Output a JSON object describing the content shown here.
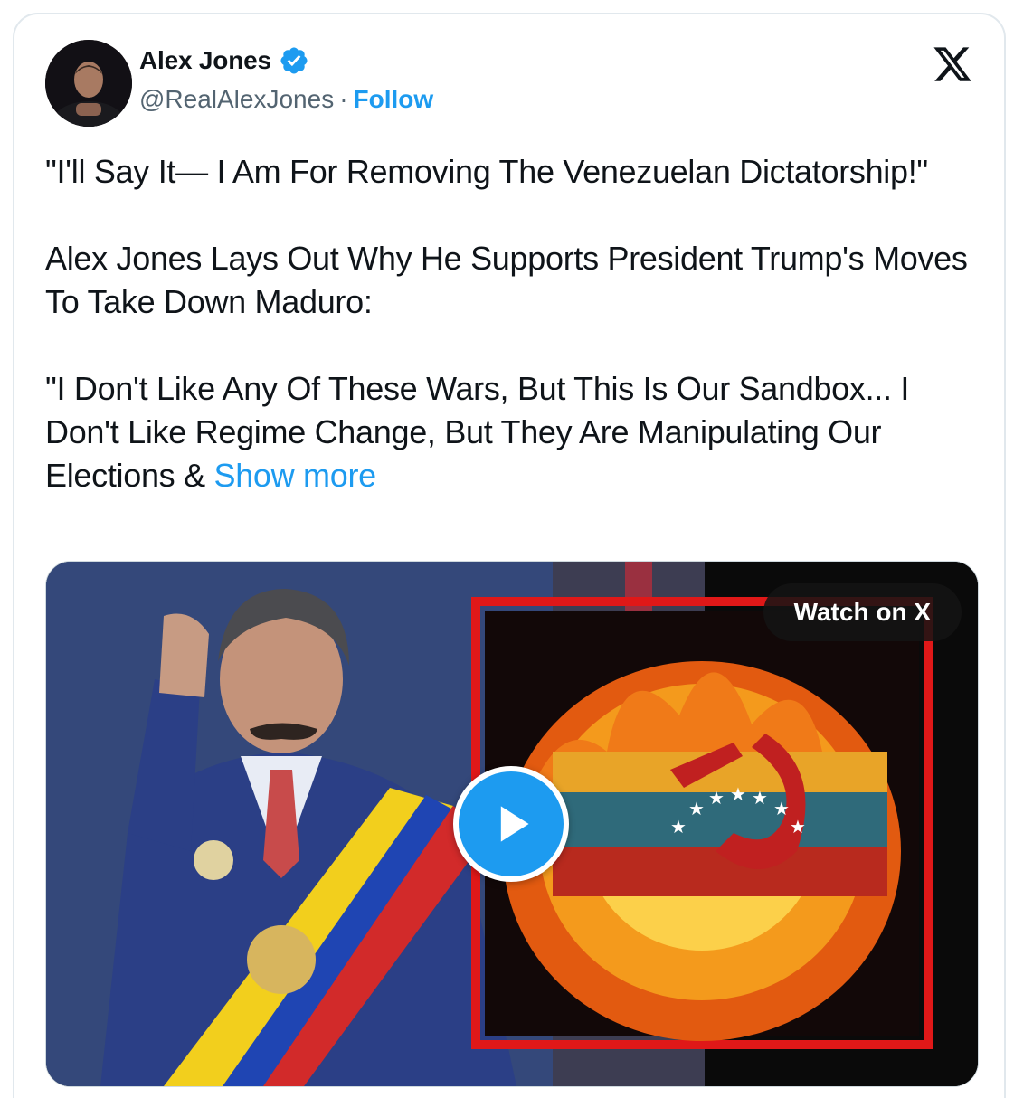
{
  "author": {
    "name": "Alex Jones",
    "handle": "@RealAlexJones",
    "separator": "·",
    "follow_label": "Follow",
    "verified_icon": "verified-badge-icon",
    "verified_color": "#1d9bf0"
  },
  "platform_icon": "x-logo-icon",
  "tweet": {
    "paragraph_1": "\"I'll Say It— I Am For Removing The Venezuelan Dictatorship!\"",
    "paragraph_2": "Alex Jones Lays Out Why He Supports President Trump's Moves To Take Down Maduro:",
    "paragraph_3": "\"I Don't Like Any Of These Wars, But This Is Our Sandbox... I Don't Like Regime Change, But They Are Manipulating Our Elections &",
    "show_more_label": "Show more"
  },
  "media": {
    "watch_label": "Watch on X",
    "play_icon": "play-icon"
  },
  "colors": {
    "accent": "#1d9bf0",
    "text": "#0f1419",
    "secondary": "#536471",
    "border": "#e1e8ed"
  }
}
